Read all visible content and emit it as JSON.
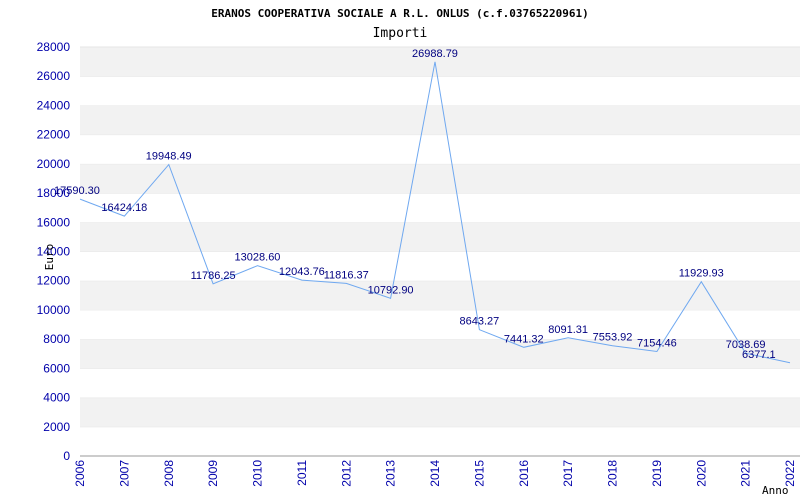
{
  "chart_data": {
    "type": "line",
    "title": "ERANOS COOPERATIVA SOCIALE A R.L. ONLUS (c.f.03765220961)",
    "subtitle": "Importi",
    "xlabel": "Anno",
    "ylabel": "Euro",
    "ylim": [
      0,
      28000
    ],
    "yticks": [
      0,
      2000,
      4000,
      6000,
      8000,
      10000,
      12000,
      14000,
      16000,
      18000,
      20000,
      22000,
      24000,
      26000,
      28000
    ],
    "grid": "horizontal alternating bands",
    "line_color": "#6fa8f0",
    "categories": [
      "2006",
      "2007",
      "2008",
      "2009",
      "2010",
      "2011",
      "2012",
      "2013",
      "2014",
      "2015",
      "2016",
      "2017",
      "2018",
      "2019",
      "2020",
      "2021",
      "2022"
    ],
    "values": [
      17590.3,
      16424.18,
      19948.49,
      11786.25,
      13028.6,
      12043.76,
      11816.37,
      10792.9,
      26988.79,
      8643.27,
      7441.32,
      8091.31,
      7553.92,
      7154.46,
      11929.93,
      7038.69,
      6377.1
    ],
    "value_labels": [
      "17590.30",
      "16424.18",
      "19948.49",
      "11786.25",
      "13028.60",
      "12043.76",
      "11816.37",
      "10792.90",
      "26988.79",
      "8643.27",
      "7441.32",
      "8091.31",
      "7553.92",
      "7154.46",
      "11929.93",
      "7038.69",
      "6377.1"
    ]
  }
}
